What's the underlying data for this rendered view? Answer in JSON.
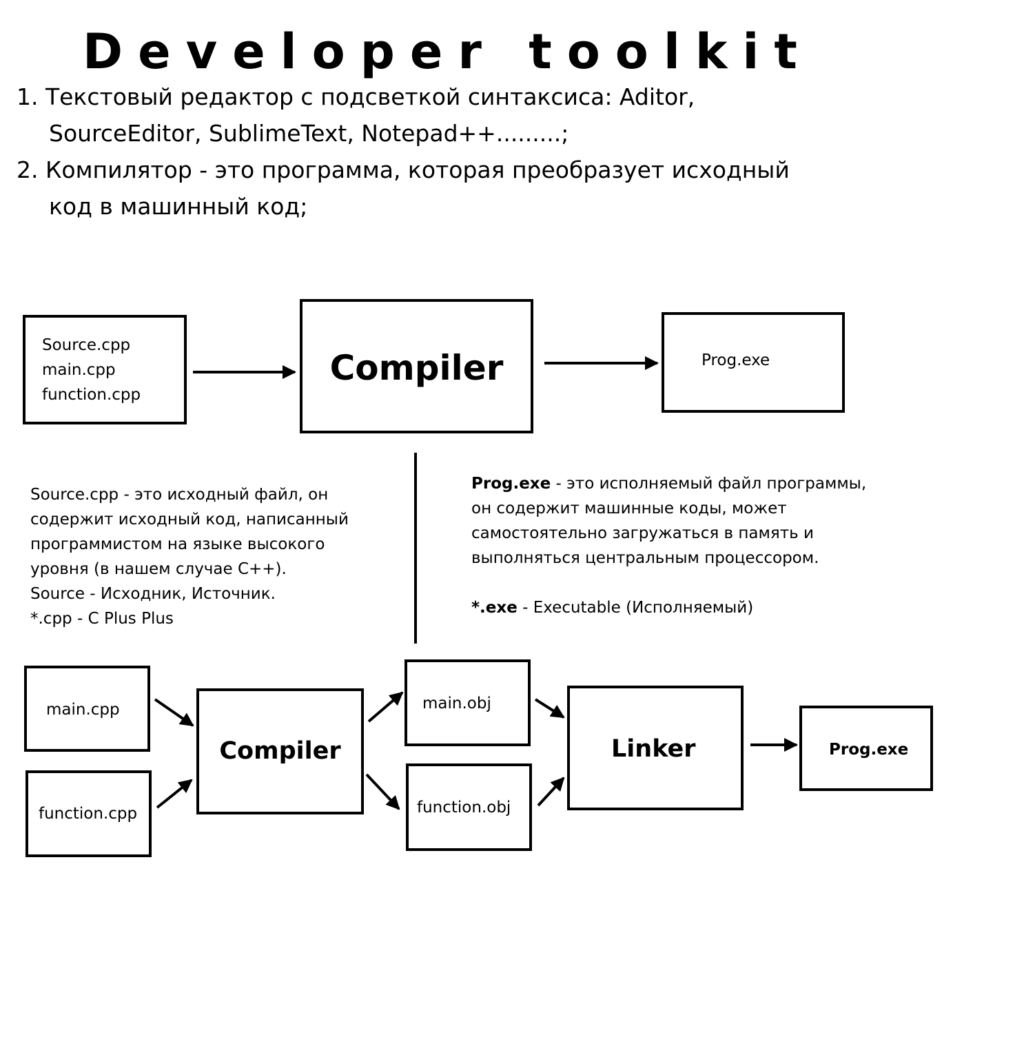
{
  "title": "Developer toolkit",
  "list": {
    "item1_line1": "1. Текстовый редактор с подсветкой синтаксиса: Aditor,",
    "item1_line2": "SourceEditor, SublimeText, Notepad++.........;",
    "item2_line1": "2. Компилятор - это программа, которая преобразует исходный",
    "item2_line2": "код в машинный код;"
  },
  "diagram1": {
    "source_files": [
      "Source.cpp",
      "main.cpp",
      "function.cpp"
    ],
    "compiler_label": "Compiler",
    "output_label": "Prog.exe"
  },
  "source_description": {
    "lines": [
      "Source.cpp - это исходный файл, он",
      "содержит исходный код, написанный",
      "программистом на языке высокого",
      "уровня (в нашем случае С++).",
      "Source - Исходник, Источник.",
      "*.cpp - C Plus Plus"
    ]
  },
  "exe_description": {
    "term": "Prog.exe",
    "line1_rest": " - это исполняемый файл программы,",
    "lines": [
      "он содержит машинные коды, может",
      "самостоятельно загружаться в память и",
      "выполняться центральным процессором."
    ],
    "ext_term": "*.exe",
    "ext_rest": " - Executable (Исполняемый)"
  },
  "diagram2": {
    "input1": "main.cpp",
    "input2": "function.cpp",
    "compiler_label": "Compiler",
    "obj1": "main.obj",
    "obj2": "function.obj",
    "linker_label": "Linker",
    "output_label": "Prog.exe"
  }
}
